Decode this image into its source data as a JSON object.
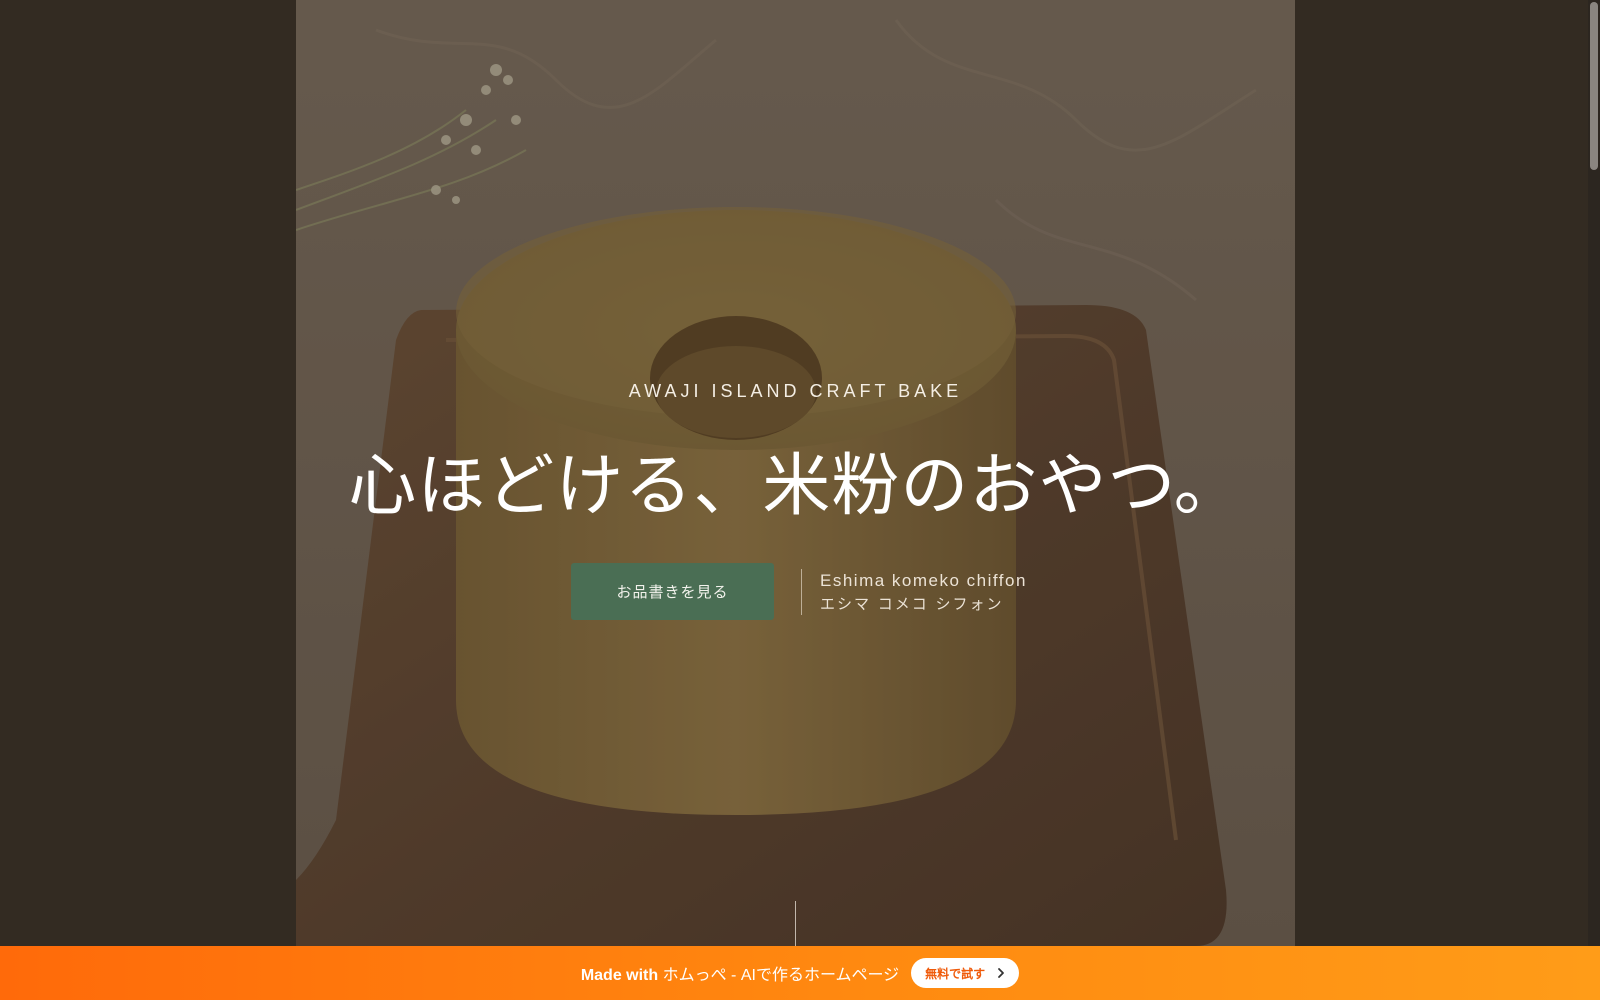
{
  "hero": {
    "eyebrow": "AWAJI ISLAND CRAFT BAKE",
    "headline": "心ほどける、米粉のおやつ。",
    "cta_label": "お品書きを見る",
    "brand_en": "Eshima komeko chiffon",
    "brand_ja": "エシマ コメコ シフォン",
    "image_icon": "chiffon-cake-photo"
  },
  "banner": {
    "made_with": "Made with",
    "product": "ホムっぺ - AIで作るホームページ",
    "button_label": "無料で試す",
    "button_icon": "chevron-right-icon",
    "colors": {
      "start": "#ff6a0a",
      "end": "#ff9c18",
      "button_text": "#ef5a0a"
    }
  },
  "colors": {
    "page_background": "#332b22",
    "cta_background": "#4a6e54"
  }
}
